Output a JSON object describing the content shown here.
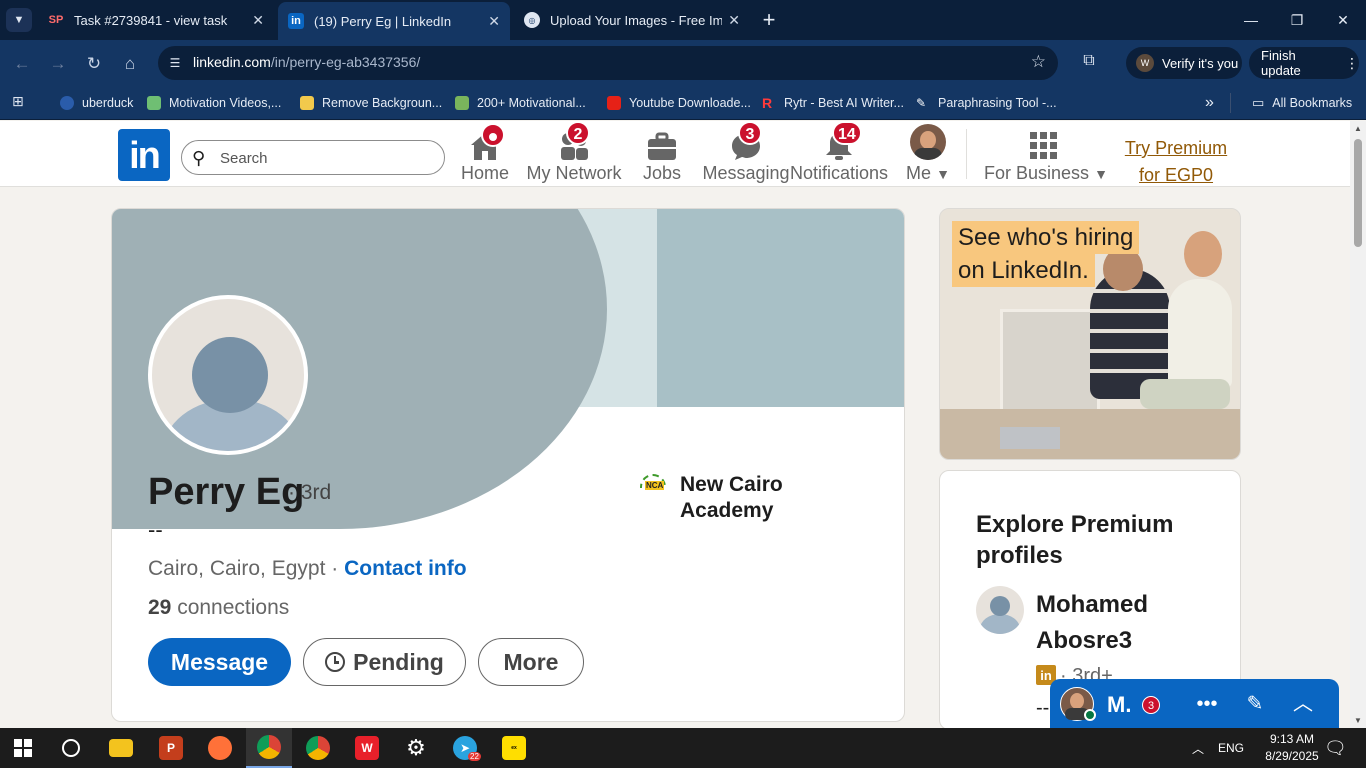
{
  "browser": {
    "tabs": [
      {
        "title": "Task #2739841 - view task",
        "favicon": "SP"
      },
      {
        "title": "(19) Perry Eg | LinkedIn",
        "favicon": "in"
      },
      {
        "title": "Upload Your Images - Free Imag",
        "favicon": "img"
      }
    ],
    "url_domain": "linkedin.com",
    "url_path": "/in/perry-eg-ab3437356/",
    "verify_label": "Verify it's you",
    "update_label": "Finish update",
    "bookmarks": [
      "uberduck",
      "Motivation Videos,...",
      "Remove Backgroun...",
      "200+ Motivational...",
      "Youtube Downloade...",
      "Rytr - Best AI Writer...",
      "Paraphrasing Tool -..."
    ],
    "all_bookmarks": "All Bookmarks",
    "more_bookmarks": "»"
  },
  "linkedin": {
    "search_placeholder": "Search",
    "nav": {
      "home": "Home",
      "network": "My Network",
      "network_badge": "2",
      "jobs": "Jobs",
      "messaging": "Messaging",
      "messaging_badge": "3",
      "notifications": "Notifications",
      "notifications_badge": "14",
      "me": "Me",
      "business": "For Business",
      "premium_line1": "Try Premium",
      "premium_line2": "for EGP0"
    },
    "profile": {
      "name": "Perry Eg",
      "degree": "· 3rd",
      "headline": "--",
      "location": "Cairo, Cairo, Egypt",
      "location_sep": " · ",
      "contact": "Contact info",
      "connections_count": "29",
      "connections_label": " connections",
      "school_line1": "New Cairo",
      "school_line2": "Academy",
      "school_logo_text": "NCA",
      "buttons": {
        "message": "Message",
        "pending": "Pending",
        "more": "More"
      }
    },
    "ad": {
      "line1": "See who's hiring",
      "line2": "on LinkedIn."
    },
    "premium_card": {
      "title": "Explore Premium profiles",
      "person_name": "Mohamed Abosre3",
      "person_degree": "· 3rd+",
      "person_headline": "--"
    },
    "messaging_overlay": {
      "label": "M.",
      "badge": "3"
    }
  },
  "taskbar": {
    "language": "ENG",
    "time": "9:13 AM",
    "date": "8/29/2025",
    "telegram_badge": "22"
  },
  "colors": {
    "linkedin_blue": "#0a66c2",
    "browser_frame": "#0b1f3a",
    "badge_red": "#cb112d",
    "premium_gold": "#915907"
  }
}
